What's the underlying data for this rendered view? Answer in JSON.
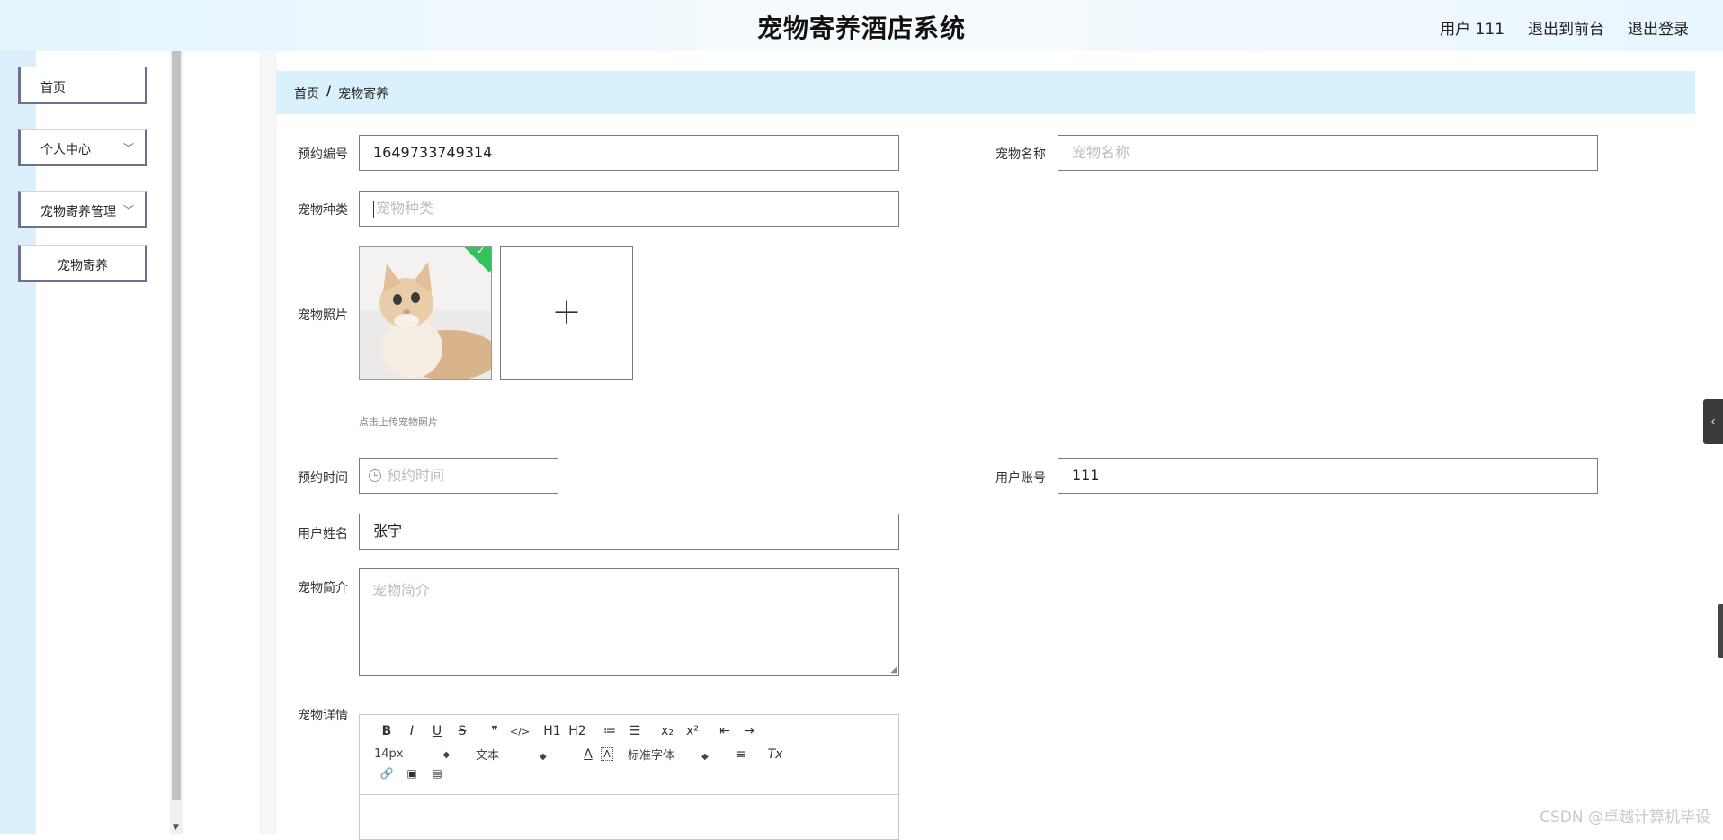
{
  "app": {
    "title": "宠物寄养酒店系统",
    "user_label": "用户 111",
    "back_front": "退出到前台",
    "logout": "退出登录"
  },
  "sidebar": {
    "items": [
      {
        "label": "首页"
      },
      {
        "label": "个人中心",
        "expandable": true
      },
      {
        "label": "宠物寄养管理",
        "expandable": true
      },
      {
        "label": "宠物寄养",
        "sub": true
      }
    ]
  },
  "breadcrumb": {
    "home": "首页",
    "separator": "/",
    "current": "宠物寄养"
  },
  "form": {
    "booking_no": {
      "label": "预约编号",
      "value": "1649733749314"
    },
    "pet_name": {
      "label": "宠物名称",
      "placeholder": "宠物名称"
    },
    "pet_type": {
      "label": "宠物种类",
      "placeholder": "宠物种类"
    },
    "pet_photo": {
      "label": "宠物照片",
      "hint": "点击上传宠物照片",
      "add_symbol": "+"
    },
    "booking_time": {
      "label": "预约时间",
      "placeholder": "预约时间"
    },
    "user_account": {
      "label": "用户账号",
      "value": "111"
    },
    "user_name": {
      "label": "用户姓名",
      "value": "张宇"
    },
    "pet_intro": {
      "label": "宠物简介",
      "placeholder": "宠物简介"
    },
    "pet_detail": {
      "label": "宠物详情"
    }
  },
  "editor": {
    "row1": [
      "B",
      "I",
      "U",
      "S",
      "❞",
      "</>",
      "H1",
      "H2",
      "≔",
      "☰",
      "x₂",
      "x²",
      "⇤",
      "⇥"
    ],
    "size_select": "14px",
    "type_select": "文本",
    "font_select": "标准字体",
    "color_btn": "A",
    "bg_btn": "A",
    "align_btn": "≡",
    "clear_btn": "Tx",
    "row3": [
      "🔗",
      "▣",
      "▤"
    ]
  },
  "watermark": "CSDN @卓越计算机毕设",
  "colors": {
    "header_bg": "#e4f4fd",
    "breadcrumb_bg": "#d9f0fd",
    "nav_border": "#6e6e8e",
    "success_badge": "#34c25f"
  }
}
